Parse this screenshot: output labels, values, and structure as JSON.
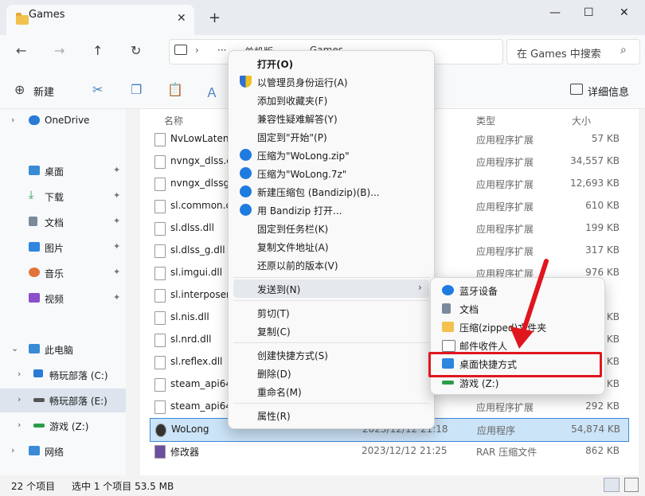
{
  "window": {
    "tab_title": "Games",
    "new_tab_glyph": "+",
    "close_tab_glyph": "✕",
    "min_glyph": "—",
    "max_glyph": "☐",
    "close_glyph": "✕"
  },
  "nav": {
    "back": "←",
    "forward": "→",
    "up": "↑",
    "refresh": "↻",
    "crumb_more": "···",
    "crumb_1": "单机版",
    "crumb_2": "Games",
    "search_placeholder": "在 Games 中搜索"
  },
  "toolbar": {
    "new_label": "新建",
    "details_label": "详细信息"
  },
  "navpane": {
    "items": [
      {
        "label": "OneDrive"
      },
      {
        "label": "桌面"
      },
      {
        "label": "下载"
      },
      {
        "label": "文档"
      },
      {
        "label": "图片"
      },
      {
        "label": "音乐"
      },
      {
        "label": "视频"
      },
      {
        "label": "此电脑"
      },
      {
        "label": "畅玩部落 (C:)"
      },
      {
        "label": "畅玩部落 (E:)"
      },
      {
        "label": "游戏 (Z:)"
      },
      {
        "label": "网络"
      }
    ]
  },
  "filelist": {
    "col_name": "名称",
    "col_type": "类型",
    "col_size": "大小",
    "rows": [
      {
        "name": "NvLowLaten",
        "date": "",
        "type": "应用程序扩展",
        "size": "57 KB"
      },
      {
        "name": "nvngx_dlss.c",
        "date": "",
        "type": "应用程序扩展",
        "size": "34,557 KB"
      },
      {
        "name": "nvngx_dlssg",
        "date": "",
        "type": "应用程序扩展",
        "size": "12,693 KB"
      },
      {
        "name": "sl.common.c",
        "date": "",
        "type": "应用程序扩展",
        "size": "610 KB"
      },
      {
        "name": "sl.dlss.dll",
        "date": "",
        "type": "应用程序扩展",
        "size": "199 KB"
      },
      {
        "name": "sl.dlss_g.dll",
        "date": "",
        "type": "应用程序扩展",
        "size": "317 KB"
      },
      {
        "name": "sl.imgui.dll",
        "date": "",
        "type": "应用程序扩展",
        "size": "976 KB"
      },
      {
        "name": "sl.interposer",
        "date": "",
        "type": "",
        "size": ""
      },
      {
        "name": "sl.nis.dll",
        "date": "",
        "type": "",
        "size": "KB"
      },
      {
        "name": "sl.nrd.dll",
        "date": "",
        "type": "",
        "size": "KB"
      },
      {
        "name": "sl.reflex.dll",
        "date": "",
        "type": "",
        "size": "KB"
      },
      {
        "name": "steam_api64",
        "date": "",
        "type": "",
        "size": "KB"
      },
      {
        "name": "steam_api64",
        "date": "",
        "type": "应用程序扩展",
        "size": "292 KB"
      },
      {
        "name": "WoLong",
        "date": "2023/12/12 21:18",
        "type": "应用程序",
        "size": "54,874 KB"
      },
      {
        "name": "修改器",
        "date": "2023/12/12 21:25",
        "type": "RAR 压缩文件",
        "size": "862 KB"
      }
    ]
  },
  "status": {
    "count": "22 个项目",
    "selected": "选中 1 个项目  53.5 MB"
  },
  "context_menu": {
    "open": "打开(O)",
    "run_admin": "以管理员身份运行(A)",
    "add_fav": "添加到收藏夹(F)",
    "compat": "兼容性疑难解答(Y)",
    "pin_start": "固定到\"开始\"(P)",
    "zip": "压缩为\"WoLong.zip\"",
    "sevenz": "压缩为\"WoLong.7z\"",
    "new_archive": "新建压缩包 (Bandizip)(B)...",
    "open_bandizip": "用 Bandizip 打开...",
    "pin_taskbar": "固定到任务栏(K)",
    "copy_path": "复制文件地址(A)",
    "restore": "还原以前的版本(V)",
    "send_to": "发送到(N)",
    "cut": "剪切(T)",
    "copy": "复制(C)",
    "shortcut": "创建快捷方式(S)",
    "delete": "删除(D)",
    "rename": "重命名(M)",
    "properties": "属性(R)"
  },
  "submenu": {
    "bluetooth": "蓝牙设备",
    "documents": "文档",
    "zipped": "压缩(zipped)文件夹",
    "mail": "邮件收件人",
    "desktop": "桌面快捷方式",
    "games": "游戏 (Z:)"
  },
  "colors": {
    "highlight": "#e0161e",
    "accent": "#0067c0"
  }
}
